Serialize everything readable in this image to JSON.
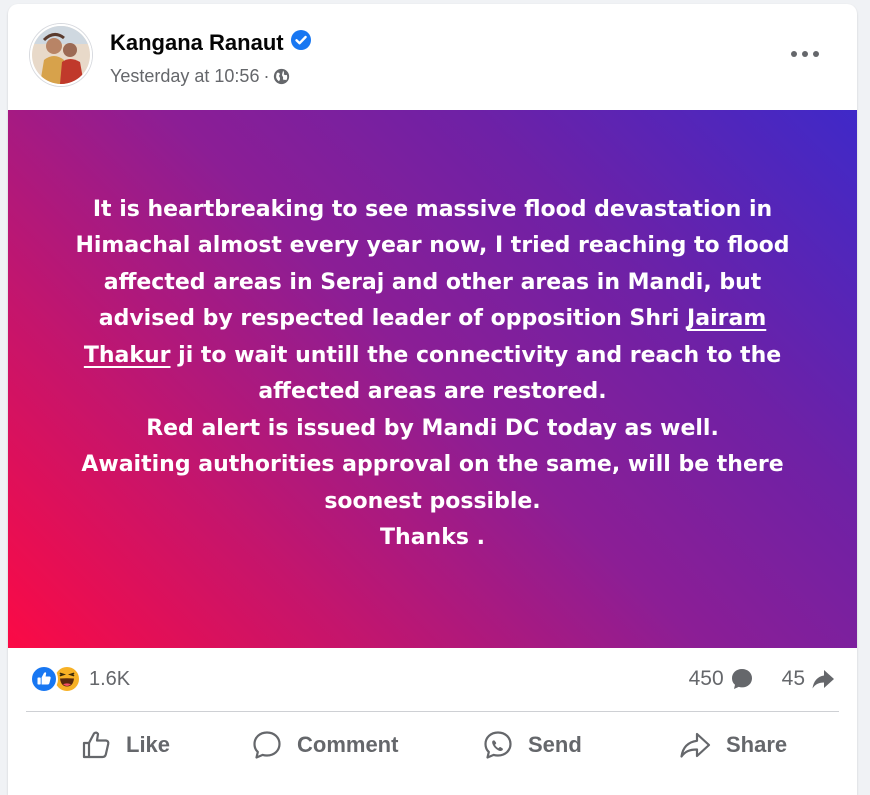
{
  "post": {
    "author": "Kangana Ranaut",
    "verified_icon": "verified-badge-icon",
    "timestamp": "Yesterday at 10:56",
    "separator": "·",
    "audience_icon": "globe-icon",
    "more_icon": "more-options-icon",
    "text_before_mention": "It is heartbreaking to see massive flood devastation in Himachal almost every year now, I tried reaching to flood affected areas in Seraj and other areas in Mandi, but advised by respected leader of opposition Shri ",
    "mention": "Jairam Thakur",
    "text_after_mention": " ji to wait untill the connectivity and reach to the affected areas are restored.",
    "line_alert": "Red alert is issued by Mandi DC today as well.",
    "line_awaiting": "Awaiting authorities approval on the same, will be there soonest possible.",
    "line_thanks": "Thanks ."
  },
  "stats": {
    "reactions_count": "1.6K",
    "reaction_icons": [
      "like-reaction-icon",
      "haha-reaction-icon"
    ],
    "comments_count": "450",
    "comments_icon": "comment-bubble-icon",
    "shares_count": "45",
    "shares_icon": "share-arrow-icon"
  },
  "actions": {
    "like": "Like",
    "comment": "Comment",
    "send": "Send",
    "share": "Share"
  },
  "colors": {
    "brand_blue": "#1877f2",
    "meta_gray": "#65676b",
    "gradient": [
      "#fb0a45",
      "#8c1e95",
      "#3f29c8"
    ]
  }
}
